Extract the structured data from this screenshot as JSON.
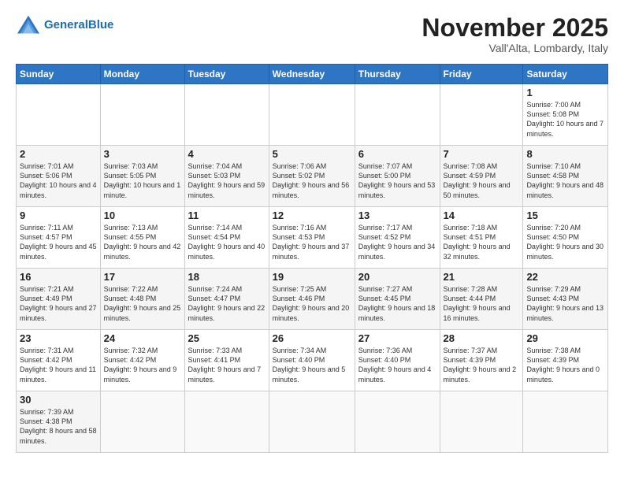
{
  "header": {
    "logo_general": "General",
    "logo_blue": "Blue",
    "month_title": "November 2025",
    "location": "Vall'Alta, Lombardy, Italy"
  },
  "weekdays": [
    "Sunday",
    "Monday",
    "Tuesday",
    "Wednesday",
    "Thursday",
    "Friday",
    "Saturday"
  ],
  "weeks": [
    [
      {
        "day": "",
        "info": ""
      },
      {
        "day": "",
        "info": ""
      },
      {
        "day": "",
        "info": ""
      },
      {
        "day": "",
        "info": ""
      },
      {
        "day": "",
        "info": ""
      },
      {
        "day": "",
        "info": ""
      },
      {
        "day": "1",
        "info": "Sunrise: 7:00 AM\nSunset: 5:08 PM\nDaylight: 10 hours\nand 7 minutes."
      }
    ],
    [
      {
        "day": "2",
        "info": "Sunrise: 7:01 AM\nSunset: 5:06 PM\nDaylight: 10 hours\nand 4 minutes."
      },
      {
        "day": "3",
        "info": "Sunrise: 7:03 AM\nSunset: 5:05 PM\nDaylight: 10 hours\nand 1 minute."
      },
      {
        "day": "4",
        "info": "Sunrise: 7:04 AM\nSunset: 5:03 PM\nDaylight: 9 hours\nand 59 minutes."
      },
      {
        "day": "5",
        "info": "Sunrise: 7:06 AM\nSunset: 5:02 PM\nDaylight: 9 hours\nand 56 minutes."
      },
      {
        "day": "6",
        "info": "Sunrise: 7:07 AM\nSunset: 5:00 PM\nDaylight: 9 hours\nand 53 minutes."
      },
      {
        "day": "7",
        "info": "Sunrise: 7:08 AM\nSunset: 4:59 PM\nDaylight: 9 hours\nand 50 minutes."
      },
      {
        "day": "8",
        "info": "Sunrise: 7:10 AM\nSunset: 4:58 PM\nDaylight: 9 hours\nand 48 minutes."
      }
    ],
    [
      {
        "day": "9",
        "info": "Sunrise: 7:11 AM\nSunset: 4:57 PM\nDaylight: 9 hours\nand 45 minutes."
      },
      {
        "day": "10",
        "info": "Sunrise: 7:13 AM\nSunset: 4:55 PM\nDaylight: 9 hours\nand 42 minutes."
      },
      {
        "day": "11",
        "info": "Sunrise: 7:14 AM\nSunset: 4:54 PM\nDaylight: 9 hours\nand 40 minutes."
      },
      {
        "day": "12",
        "info": "Sunrise: 7:16 AM\nSunset: 4:53 PM\nDaylight: 9 hours\nand 37 minutes."
      },
      {
        "day": "13",
        "info": "Sunrise: 7:17 AM\nSunset: 4:52 PM\nDaylight: 9 hours\nand 34 minutes."
      },
      {
        "day": "14",
        "info": "Sunrise: 7:18 AM\nSunset: 4:51 PM\nDaylight: 9 hours\nand 32 minutes."
      },
      {
        "day": "15",
        "info": "Sunrise: 7:20 AM\nSunset: 4:50 PM\nDaylight: 9 hours\nand 30 minutes."
      }
    ],
    [
      {
        "day": "16",
        "info": "Sunrise: 7:21 AM\nSunset: 4:49 PM\nDaylight: 9 hours\nand 27 minutes."
      },
      {
        "day": "17",
        "info": "Sunrise: 7:22 AM\nSunset: 4:48 PM\nDaylight: 9 hours\nand 25 minutes."
      },
      {
        "day": "18",
        "info": "Sunrise: 7:24 AM\nSunset: 4:47 PM\nDaylight: 9 hours\nand 22 minutes."
      },
      {
        "day": "19",
        "info": "Sunrise: 7:25 AM\nSunset: 4:46 PM\nDaylight: 9 hours\nand 20 minutes."
      },
      {
        "day": "20",
        "info": "Sunrise: 7:27 AM\nSunset: 4:45 PM\nDaylight: 9 hours\nand 18 minutes."
      },
      {
        "day": "21",
        "info": "Sunrise: 7:28 AM\nSunset: 4:44 PM\nDaylight: 9 hours\nand 16 minutes."
      },
      {
        "day": "22",
        "info": "Sunrise: 7:29 AM\nSunset: 4:43 PM\nDaylight: 9 hours\nand 13 minutes."
      }
    ],
    [
      {
        "day": "23",
        "info": "Sunrise: 7:31 AM\nSunset: 4:42 PM\nDaylight: 9 hours\nand 11 minutes."
      },
      {
        "day": "24",
        "info": "Sunrise: 7:32 AM\nSunset: 4:42 PM\nDaylight: 9 hours\nand 9 minutes."
      },
      {
        "day": "25",
        "info": "Sunrise: 7:33 AM\nSunset: 4:41 PM\nDaylight: 9 hours\nand 7 minutes."
      },
      {
        "day": "26",
        "info": "Sunrise: 7:34 AM\nSunset: 4:40 PM\nDaylight: 9 hours\nand 5 minutes."
      },
      {
        "day": "27",
        "info": "Sunrise: 7:36 AM\nSunset: 4:40 PM\nDaylight: 9 hours\nand 4 minutes."
      },
      {
        "day": "28",
        "info": "Sunrise: 7:37 AM\nSunset: 4:39 PM\nDaylight: 9 hours\nand 2 minutes."
      },
      {
        "day": "29",
        "info": "Sunrise: 7:38 AM\nSunset: 4:39 PM\nDaylight: 9 hours\nand 0 minutes."
      }
    ],
    [
      {
        "day": "30",
        "info": "Sunrise: 7:39 AM\nSunset: 4:38 PM\nDaylight: 8 hours\nand 58 minutes."
      },
      {
        "day": "",
        "info": ""
      },
      {
        "day": "",
        "info": ""
      },
      {
        "day": "",
        "info": ""
      },
      {
        "day": "",
        "info": ""
      },
      {
        "day": "",
        "info": ""
      },
      {
        "day": "",
        "info": ""
      }
    ]
  ]
}
